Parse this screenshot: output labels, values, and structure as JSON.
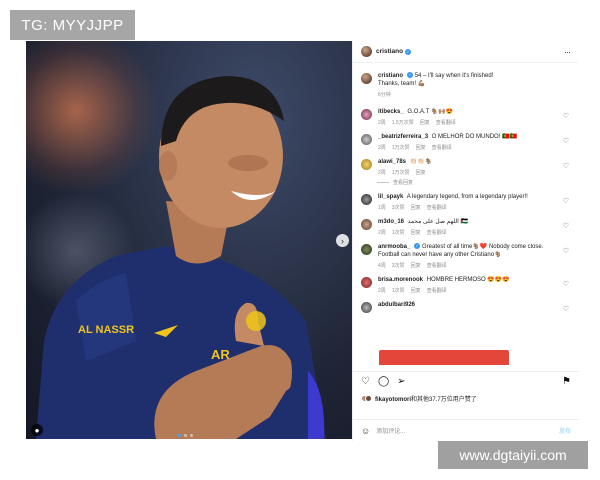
{
  "watermarks": {
    "top": "TG: MYYJJPP",
    "bottom": "www.dgtaiyii.com"
  },
  "photo": {
    "jersey_text": "AL NASSR",
    "sponsor_text": "AR",
    "carousel_next_icon": "chevron-right-icon",
    "tag_icon": "person-tag-icon"
  },
  "header": {
    "username": "cristiano",
    "more_icon": "ellipsis-icon"
  },
  "caption": {
    "username": "cristiano",
    "text": "54 – I'll say when it's finished!",
    "text2": "Thanks, team! 💪🏽",
    "time": "6分钟"
  },
  "comments": [
    {
      "user": "itibecks_",
      "text": "G.O.A.T 🐐🙌🏽😍",
      "time": "2周",
      "likes": "1.5万次赞",
      "reply": "回复",
      "translate": "查看翻译"
    },
    {
      "user": "_beatrizferreira_3",
      "text": "O MELHOR DO MUNDO! 🇵🇹🇵🇹",
      "time": "2周",
      "likes": "1万次赞",
      "reply": "回复",
      "translate": "查看翻译"
    },
    {
      "user": "alawi_78s",
      "text": "👏🏻👏🏻🐐",
      "time": "2周",
      "likes": "1万次赞",
      "reply": "回复",
      "translate": "",
      "view_replies": "查看回复"
    },
    {
      "user": "lil_spayk",
      "text": "A legendary legend, from a legendary player!!",
      "time": "1周",
      "likes": "3次赞",
      "reply": "回复",
      "translate": "查看翻译"
    },
    {
      "user": "m3do_16",
      "text": "اللهم صل على محمد 🇵🇸",
      "time": "2周",
      "likes": "1次赞",
      "reply": "回复",
      "translate": "查看翻译"
    },
    {
      "user": "anrmooba_",
      "text": "Greatest of all time🐐❤️ Nobody come close. Football can never have any other Cristiano🐐",
      "time": "4周",
      "likes": "3次赞",
      "reply": "回复",
      "translate": "查看翻译"
    },
    {
      "user": "brisa.morenook",
      "text": "HOMBRE HERMOSO 😍😍😍",
      "time": "2周",
      "likes": "1次赞",
      "reply": "回复",
      "translate": "查看翻译"
    },
    {
      "user": "abdulbari926",
      "text": ""
    }
  ],
  "actions": {
    "like_icon": "heart-icon",
    "comment_icon": "comment-icon",
    "share_icon": "send-icon",
    "save_icon": "bookmark-icon"
  },
  "likes": {
    "text": "fikayotomori和其他37.7万位用户赞了",
    "user": "fikayotomori",
    "rest": "和其他37.7万位用户赞了"
  },
  "composer": {
    "placeholder": "添加评论...",
    "post": "发布",
    "emoji_icon": "smiley-icon"
  }
}
